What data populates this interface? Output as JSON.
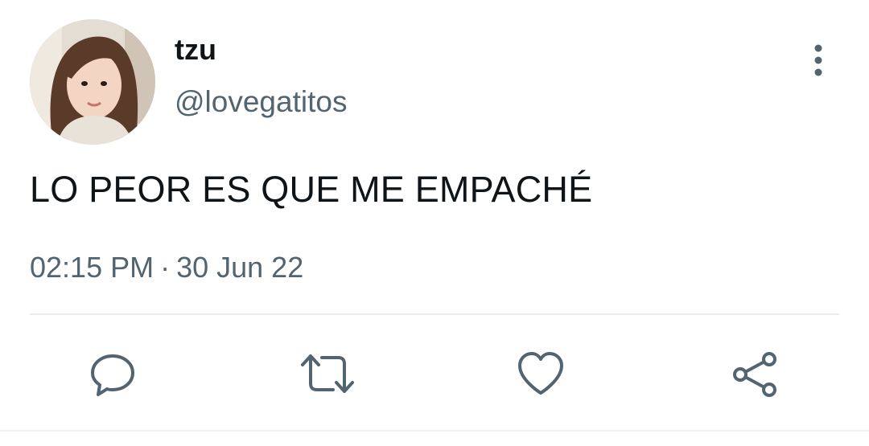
{
  "tweet": {
    "display_name": "tzu",
    "handle": "@lovegatitos",
    "text": "LO PEOR ES QUE ME EMPACHÉ",
    "time": "02:15 PM",
    "separator": "·",
    "date": "30 Jun 22"
  },
  "icons": {
    "more": "more-vertical-icon",
    "reply": "reply-icon",
    "retweet": "retweet-icon",
    "like": "heart-icon",
    "share": "share-icon"
  },
  "colors": {
    "text_primary": "#0f1419",
    "text_secondary": "#536471",
    "divider": "#e6ecf0",
    "icon": "#536471"
  }
}
